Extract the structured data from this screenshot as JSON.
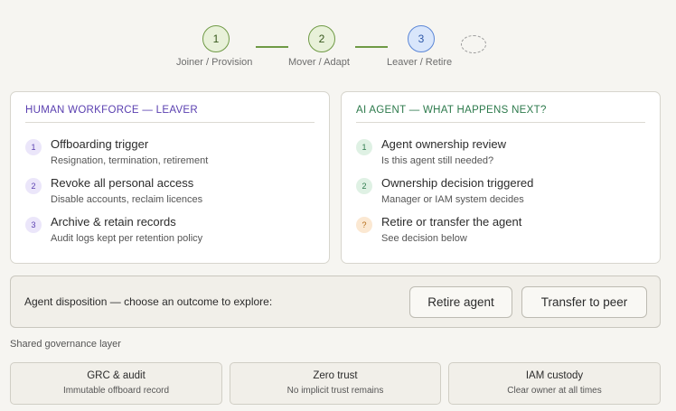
{
  "stepper": {
    "steps": [
      {
        "number": "1",
        "label": "Joiner / Provision",
        "state": "done"
      },
      {
        "number": "2",
        "label": "Mover / Adapt",
        "state": "done"
      },
      {
        "number": "3",
        "label": "Leaver / Retire",
        "state": "active"
      }
    ]
  },
  "human_card": {
    "title": "HUMAN WORKFORCE — LEAVER",
    "items": [
      {
        "badge": "1",
        "title": "Offboarding trigger",
        "desc": "Resignation, termination, retirement"
      },
      {
        "badge": "2",
        "title": "Revoke all personal access",
        "desc": "Disable accounts, reclaim licences"
      },
      {
        "badge": "3",
        "title": "Archive & retain records",
        "desc": "Audit logs kept per retention policy"
      }
    ]
  },
  "ai_card": {
    "title": "AI AGENT — WHAT HAPPENS NEXT?",
    "items": [
      {
        "badge": "1",
        "title": "Agent ownership review",
        "desc": "Is this agent still needed?"
      },
      {
        "badge": "2",
        "title": "Ownership decision triggered",
        "desc": "Manager or IAM system decides"
      },
      {
        "badge": "?",
        "title": "Retire or transfer the agent",
        "desc": "See decision below"
      }
    ]
  },
  "disposition": {
    "label": "Agent disposition — choose an outcome to explore:",
    "retire_label": "Retire agent",
    "transfer_label": "Transfer to peer"
  },
  "governance": {
    "label": "Shared governance layer",
    "boxes": [
      {
        "title": "GRC & audit",
        "desc": "Immutable offboard record"
      },
      {
        "title": "Zero trust",
        "desc": "No implicit trust remains"
      },
      {
        "title": "IAM custody",
        "desc": "Clear owner at all times"
      }
    ]
  },
  "colors": {
    "background": "#f6f5f1",
    "step_done": "#6f9a45",
    "step_active": "#5b86d6",
    "human_accent": "#5a3fb0",
    "ai_accent": "#2d7a4c",
    "question_badge": "#b36a16"
  }
}
